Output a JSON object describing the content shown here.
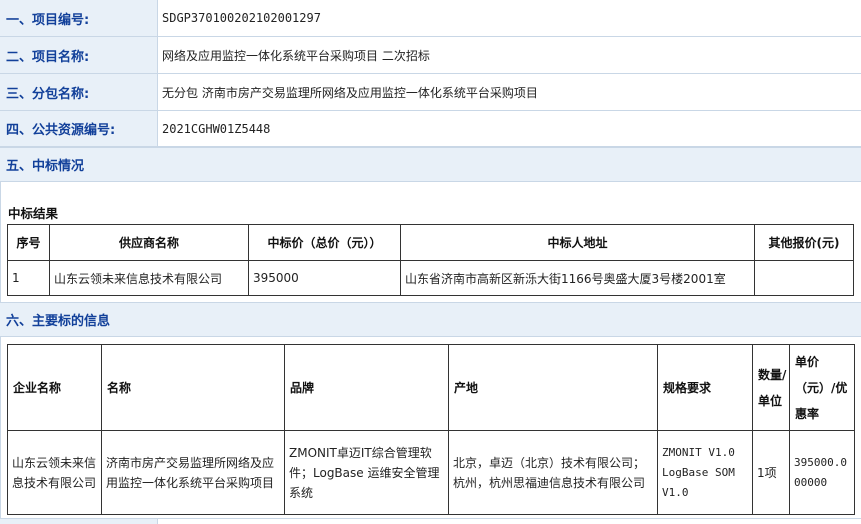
{
  "info": {
    "project_no": {
      "label": "一、项目编号:",
      "value": "SDGP370100202102001297"
    },
    "project_name": {
      "label": "二、项目名称:",
      "value": "网络及应用监控一体化系统平台采购项目 二次招标"
    },
    "package_name": {
      "label": "三、分包名称:",
      "value": "无分包 济南市房产交易监理所网络及应用监控一体化系统平台采购项目"
    },
    "public_resource_no": {
      "label": "四、公共资源编号:",
      "value": "2021CGHW01Z5448"
    }
  },
  "section5": {
    "title": "五、中标情况",
    "subtitle": "中标结果",
    "headers": [
      "序号",
      "供应商名称",
      "中标价（总价（元））",
      "中标人地址",
      "其他报价(元)"
    ],
    "rows": [
      [
        "1",
        "山东云领未来信息技术有限公司",
        "395000",
        "山东省济南市高新区新泺大街1166号奥盛大厦3号楼2001室",
        ""
      ]
    ]
  },
  "section6": {
    "title": "六、主要标的信息",
    "headers": [
      "企业名称",
      "名称",
      "品牌",
      "产地",
      "规格要求",
      "数量/单位",
      "单价（元）/优惠率"
    ],
    "rows": [
      [
        "山东云领未来信息技术有限公司",
        "济南市房产交易监理所网络及应用监控一体化系统平台采购项目",
        "ZMONIT卓迈IT综合管理软件；LogBase 运维安全管理系统",
        "北京，卓迈（北京）技术有限公司；杭州，杭州思福迪信息技术有限公司",
        "ZMONIT V1.0 LogBase SOM V1.0",
        "1项",
        "395000.000000"
      ]
    ]
  }
}
